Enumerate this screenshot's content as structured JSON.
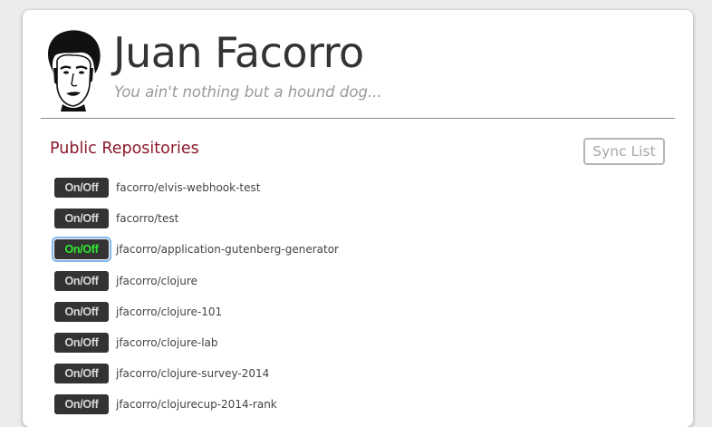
{
  "profile": {
    "name": "Juan Facorro",
    "tagline": "You ain't nothing but a hound dog...",
    "avatar_icon": "elvis-portrait-icon"
  },
  "repos": {
    "title": "Public Repositories",
    "sync_label": "Sync List",
    "toggle_label": "On/Off",
    "items": [
      {
        "name": "facorro/elvis-webhook-test",
        "active": false
      },
      {
        "name": "facorro/test",
        "active": false
      },
      {
        "name": "jfacorro/application-gutenberg-generator",
        "active": true
      },
      {
        "name": "jfacorro/clojure",
        "active": false
      },
      {
        "name": "jfacorro/clojure-101",
        "active": false
      },
      {
        "name": "jfacorro/clojure-lab",
        "active": false
      },
      {
        "name": "jfacorro/clojure-survey-2014",
        "active": false
      },
      {
        "name": "jfacorro/clojurecup-2014-rank",
        "active": false
      }
    ]
  },
  "colors": {
    "section_title": "#8b1a2b",
    "toggle_bg": "#333333",
    "toggle_active_text": "#2ee82e",
    "focus_ring": "#7fb6ec"
  }
}
